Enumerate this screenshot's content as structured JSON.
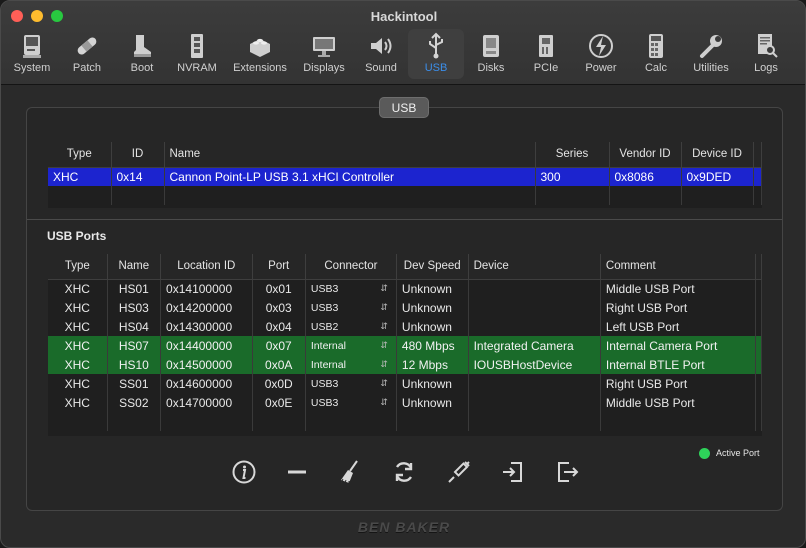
{
  "window": {
    "title": "Hackintool"
  },
  "toolbar": {
    "items": [
      {
        "label": "System",
        "icon": "computer-icon"
      },
      {
        "label": "Patch",
        "icon": "bandage-icon"
      },
      {
        "label": "Boot",
        "icon": "boot-icon"
      },
      {
        "label": "NVRAM",
        "icon": "memory-icon"
      },
      {
        "label": "Extensions",
        "icon": "lego-brick-icon"
      },
      {
        "label": "Displays",
        "icon": "monitor-icon"
      },
      {
        "label": "Sound",
        "icon": "speaker-icon"
      },
      {
        "label": "USB",
        "icon": "usb-icon",
        "active": true
      },
      {
        "label": "Disks",
        "icon": "disk-icon"
      },
      {
        "label": "PCIe",
        "icon": "pcie-card-icon"
      },
      {
        "label": "Power",
        "icon": "lightning-icon"
      },
      {
        "label": "Calc",
        "icon": "calculator-icon"
      },
      {
        "label": "Utilities",
        "icon": "wrench-icon"
      },
      {
        "label": "Logs",
        "icon": "log-search-icon"
      }
    ]
  },
  "segment": {
    "label": "USB"
  },
  "controllers": {
    "columns": [
      "Type",
      "ID",
      "Name",
      "Series",
      "Vendor  ID",
      "Device  ID"
    ],
    "rows": [
      {
        "type": "XHC",
        "id": "0x14",
        "name": "Cannon Point-LP USB 3.1 xHCI Controller",
        "series": "300",
        "vendor_id": "0x8086",
        "device_id": "0x9DED"
      }
    ]
  },
  "usb_ports": {
    "title": "USB Ports",
    "columns": [
      "Type",
      "Name",
      "Location ID",
      "Port",
      "Connector",
      "Dev Speed",
      "Device",
      "Comment"
    ],
    "rows": [
      {
        "type": "XHC",
        "name": "HS01",
        "location_id": "0x14100000",
        "port": "0x01",
        "connector": "USB3",
        "speed": "Unknown",
        "device": "",
        "comment": "Middle USB Port",
        "active": false
      },
      {
        "type": "XHC",
        "name": "HS03",
        "location_id": "0x14200000",
        "port": "0x03",
        "connector": "USB3",
        "speed": "Unknown",
        "device": "",
        "comment": "Right USB Port",
        "active": false
      },
      {
        "type": "XHC",
        "name": "HS04",
        "location_id": "0x14300000",
        "port": "0x04",
        "connector": "USB2",
        "speed": "Unknown",
        "device": "",
        "comment": "Left USB Port",
        "active": false
      },
      {
        "type": "XHC",
        "name": "HS07",
        "location_id": "0x14400000",
        "port": "0x07",
        "connector": "Internal",
        "speed": "480 Mbps",
        "device": "Integrated Camera",
        "comment": "Internal Camera Port",
        "active": true
      },
      {
        "type": "XHC",
        "name": "HS10",
        "location_id": "0x14500000",
        "port": "0x0A",
        "connector": "Internal",
        "speed": "12 Mbps",
        "device": "IOUSBHostDevice",
        "comment": "Internal BTLE Port",
        "active": true
      },
      {
        "type": "XHC",
        "name": "SS01",
        "location_id": "0x14600000",
        "port": "0x0D",
        "connector": "USB3",
        "speed": "Unknown",
        "device": "",
        "comment": "Right USB Port",
        "active": false
      },
      {
        "type": "XHC",
        "name": "SS02",
        "location_id": "0x14700000",
        "port": "0x0E",
        "connector": "USB3",
        "speed": "Unknown",
        "device": "",
        "comment": "Middle USB Port",
        "active": false
      }
    ]
  },
  "legend": {
    "active_label": "Active Port",
    "active_color": "#2ed35a"
  },
  "colors": {
    "selected_row": "#1c24cf",
    "active_row": "#1a6b2a",
    "accent": "#3b8eea"
  },
  "actions": [
    {
      "name": "info-button",
      "icon": "info-icon"
    },
    {
      "name": "remove-button",
      "icon": "minus-icon"
    },
    {
      "name": "clear-button",
      "icon": "broom-icon"
    },
    {
      "name": "refresh-button",
      "icon": "refresh-icon"
    },
    {
      "name": "inject-button",
      "icon": "syringe-icon"
    },
    {
      "name": "import-button",
      "icon": "import-icon"
    },
    {
      "name": "export-button",
      "icon": "export-icon"
    }
  ],
  "footer": {
    "logo_text": "BEN BAKER"
  }
}
